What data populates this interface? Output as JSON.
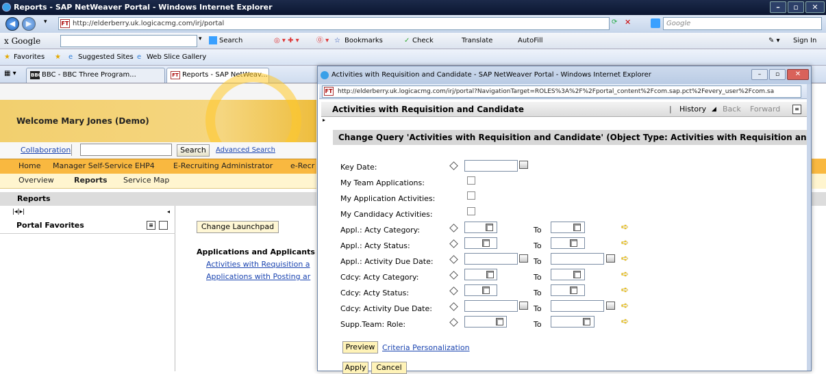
{
  "window": {
    "title": "Reports - SAP NetWeaver Portal - Windows Internet Explorer",
    "url": "http://elderberry.uk.logicacmg.com/irj/portal",
    "google_placeholder": "Google"
  },
  "toolbar": {
    "google_label": "x Google",
    "search": "Search",
    "bookmarks": "Bookmarks",
    "check": "Check",
    "translate": "Translate",
    "autofill": "AutoFill",
    "sign_in": "Sign In"
  },
  "favorites": {
    "favorites_label": "Favorites",
    "suggested": "Suggested Sites",
    "webslice": "Web Slice Gallery"
  },
  "tabs": [
    {
      "label": "BBC - BBC Three Program..."
    },
    {
      "label": "Reports - SAP NetWeav..."
    }
  ],
  "portal": {
    "welcome": "Welcome Mary Jones (Demo)",
    "collaboration": "Collaboration",
    "search_button": "Search",
    "advanced_search": "Advanced Search",
    "topnav": [
      "Home",
      "Manager Self-Service EHP4",
      "E-Recruiting Administrator",
      "e-Recr"
    ],
    "subnav": [
      "Overview",
      "Reports",
      "Service Map"
    ],
    "reports_title": "Reports",
    "portal_favorites": "Portal Favorites",
    "change_launchpad": "Change Launchpad",
    "apps_heading": "Applications and Applicants",
    "links": [
      "Activities with Requisition a",
      "Applications with Posting ar"
    ]
  },
  "popup": {
    "title": "Activities with Requisition and Candidate - SAP NetWeaver Portal - Windows Internet Explorer",
    "url": "http://elderberry.uk.logicacmg.com/irj/portal?NavigationTarget=ROLES%3A%2F%2Fportal_content%2Fcom.sap.pct%2Fevery_user%2Fcom.sa",
    "header": "Activities with Requisition and Candidate",
    "history": "History",
    "back": "Back",
    "forward": "Forward",
    "query_title": "Change Query 'Activities with Requisition and Candidate' (Object Type: Activities with Requisition and Can",
    "fields": [
      "Key Date:",
      "My Team Applications:",
      "My Application Activities:",
      "My Candidacy Activities:",
      "Appl.: Acty Category:",
      "Appl.: Acty Status:",
      "Appl.: Activity Due Date:",
      "Cdcy: Acty Category:",
      "Cdcy: Acty Status:",
      "Cdcy: Activity Due Date:",
      "Supp.Team: Role:"
    ],
    "to_label": "To",
    "preview": "Preview",
    "criteria": "Criteria Personalization",
    "apply": "Apply",
    "cancel": "Cancel"
  }
}
